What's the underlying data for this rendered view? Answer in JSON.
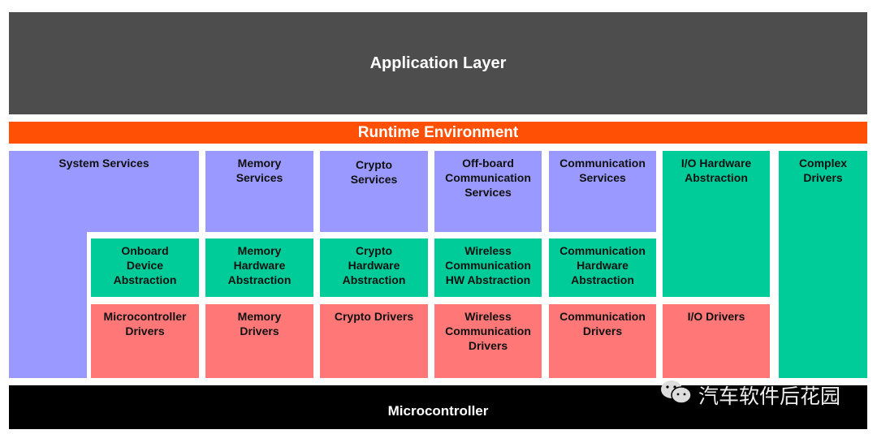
{
  "application_layer": "Application Layer",
  "runtime_environment": "Runtime Environment",
  "microcontroller": "Microcontroller",
  "services": {
    "system": "System Services",
    "memory": "Memory\nServices",
    "crypto": "Crypto\nServices",
    "offboard": "Off-board\nCommunication\nServices",
    "communication": "Communication\nServices"
  },
  "abstraction": {
    "onboard": "Onboard\nDevice\nAbstraction",
    "memory": "Memory\nHardware\nAbstraction",
    "crypto": "Crypto\nHardware\nAbstraction",
    "wireless": "Wireless\nCommunication\nHW Abstraction",
    "communication": "Communication\nHardware\nAbstraction",
    "io": "I/O Hardware\nAbstraction"
  },
  "drivers": {
    "microcontroller": "Microcontroller\nDrivers",
    "memory": "Memory\nDrivers",
    "crypto": "Crypto Drivers",
    "wireless": "Wireless\nCommunication\nDrivers",
    "communication": "Communication\nDrivers",
    "io": "I/O Drivers"
  },
  "complex_drivers": "Complex\nDrivers",
  "watermark": "汽车软件后花园",
  "colors": {
    "application": "#4d4d4d",
    "rte": "#ff5005",
    "services": "#9999ff",
    "abstraction": "#00cc99",
    "drivers": "#ff7777",
    "microcontroller": "#000000"
  }
}
